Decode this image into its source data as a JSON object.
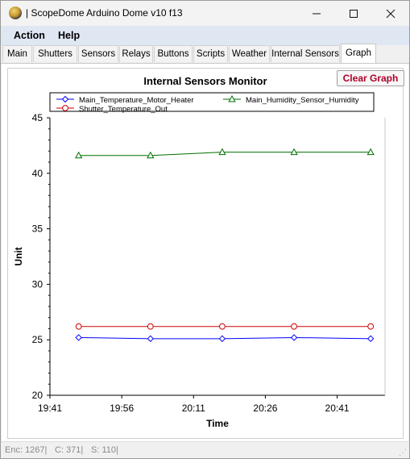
{
  "window": {
    "title": "| ScopeDome Arduino Dome v10 f13"
  },
  "menu": {
    "items": [
      {
        "label": "Action"
      },
      {
        "label": "Help"
      }
    ]
  },
  "tabs": [
    {
      "label": "Main"
    },
    {
      "label": "Shutters"
    },
    {
      "label": "Sensors"
    },
    {
      "label": "Relays"
    },
    {
      "label": "Buttons"
    },
    {
      "label": "Scripts"
    },
    {
      "label": "Weather"
    },
    {
      "label": "Internal Sensors"
    },
    {
      "label": "Graph",
      "active": true
    }
  ],
  "toolbar": {
    "clear_label": "Clear Graph"
  },
  "chart_data": {
    "type": "line",
    "title": "Internal Sensors Monitor",
    "xlabel": "Time",
    "ylabel": "Unit",
    "ylim": [
      20,
      45
    ],
    "yticks": [
      "20",
      "25",
      "30",
      "35",
      "40",
      "45"
    ],
    "xlim": [
      "19:41",
      "20:51"
    ],
    "xticks": [
      "19:41",
      "19:56",
      "20:11",
      "20:26",
      "20:41"
    ],
    "grid": false,
    "legend_position": "top",
    "series": [
      {
        "name": "Main_Temperature_Motor_Heater",
        "color": "#0000ff",
        "marker": "diamond",
        "x": [
          "19:47",
          "20:02",
          "20:17",
          "20:32",
          "20:48"
        ],
        "values": [
          25.2,
          25.1,
          25.1,
          25.2,
          25.1
        ]
      },
      {
        "name": "Main_Humidity_Sensor_Humidity",
        "color": "#007000",
        "marker": "triangle",
        "x": [
          "19:47",
          "20:02",
          "20:17",
          "20:32",
          "20:48"
        ],
        "values": [
          41.6,
          41.6,
          41.9,
          41.9,
          41.9
        ]
      },
      {
        "name": "Shutter_Temperature_Out",
        "color": "#cc0000",
        "marker": "circle",
        "x": [
          "19:47",
          "20:02",
          "20:17",
          "20:32",
          "20:48"
        ],
        "values": [
          26.2,
          26.2,
          26.2,
          26.2,
          26.2
        ]
      }
    ]
  },
  "status": {
    "items": [
      {
        "text": "Enc: 1267|"
      },
      {
        "text": "C: 371|"
      },
      {
        "text": "S: 110|"
      }
    ]
  }
}
